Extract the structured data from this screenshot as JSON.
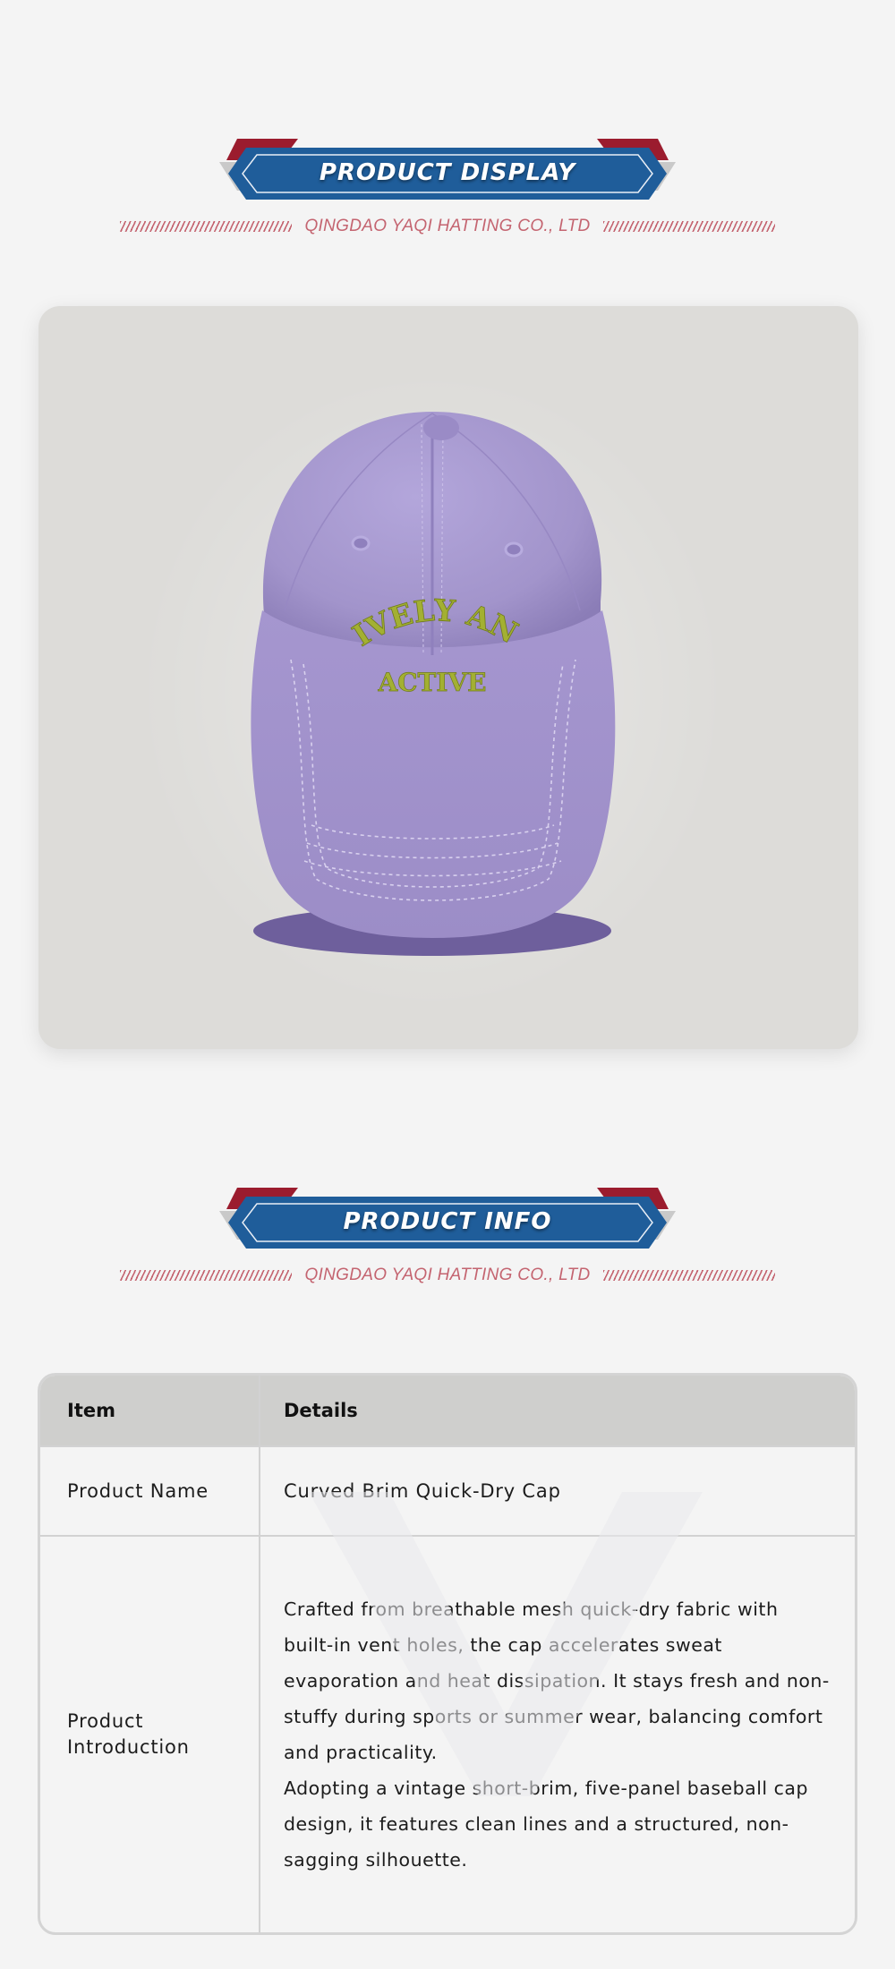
{
  "sections": {
    "display": {
      "title": "PRODUCT DISPLAY",
      "company": "QINGDAO YAQI HATTING CO., LTD"
    },
    "info": {
      "title": "PRODUCT INFO",
      "company": "QINGDAO YAQI HATTING CO., LTD"
    }
  },
  "product_image": {
    "embroidery_line1": "LIVELY AND",
    "embroidery_line2": "ACTIVE",
    "cap_color": "#a799cf",
    "embroidery_color": "#a3b032"
  },
  "table": {
    "header": {
      "item": "Item",
      "details": "Details"
    },
    "rows": {
      "name": {
        "item": "Product Name",
        "details": "Curved Brim Quick-Dry Cap"
      },
      "intro": {
        "item": "Product Introduction",
        "paragraph1": "Crafted from breathable mesh quick-dry fabric with built-in vent holes, the cap accelerates sweat evaporation and heat dissipation. It stays fresh and non-stuffy during sports or summer wear, balancing comfort and practicality.",
        "paragraph2": "Adopting a vintage short-brim, five-panel baseball cap design, it features clean lines and a structured, non-sagging silhouette."
      }
    }
  },
  "colors": {
    "banner_blue": "#1f5d9a",
    "banner_red": "#9b1c2e",
    "accent_pink": "#c46470",
    "page_bg": "#f4f4f4"
  }
}
